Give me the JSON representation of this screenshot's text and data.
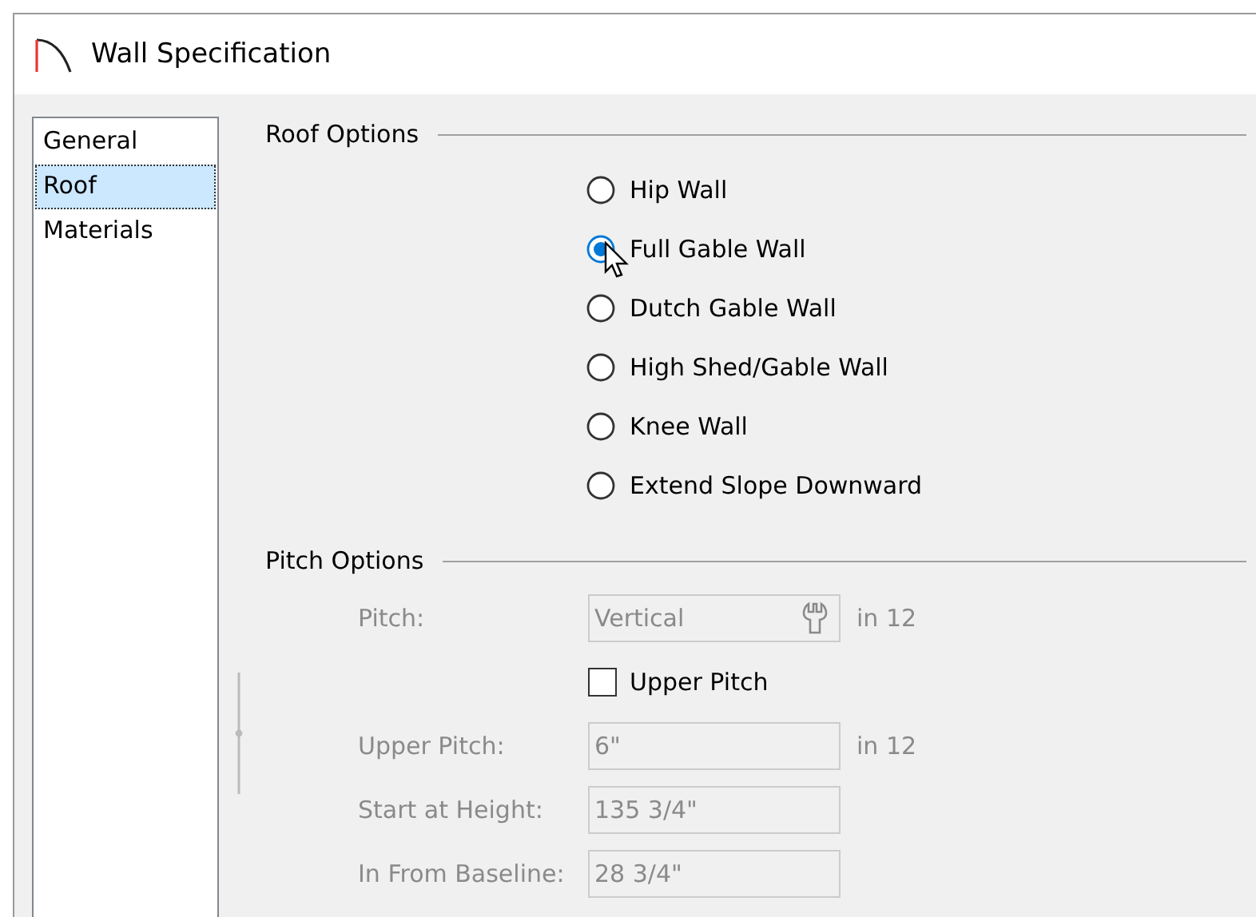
{
  "window": {
    "title": "Wall Specification"
  },
  "sidebar": {
    "items": [
      {
        "label": "General",
        "selected": false
      },
      {
        "label": "Roof",
        "selected": true
      },
      {
        "label": "Materials",
        "selected": false
      }
    ]
  },
  "roof_options": {
    "title": "Roof Options",
    "options": [
      {
        "label": "Hip Wall",
        "selected": false
      },
      {
        "label": "Full Gable Wall",
        "selected": true
      },
      {
        "label": "Dutch Gable Wall",
        "selected": false
      },
      {
        "label": "High Shed/Gable Wall",
        "selected": false
      },
      {
        "label": "Knee Wall",
        "selected": false
      },
      {
        "label": "Extend Slope Downward",
        "selected": false
      }
    ]
  },
  "pitch_options": {
    "title": "Pitch Options",
    "rows": [
      {
        "kind": "field",
        "label": "Pitch:",
        "value": "Vertical",
        "unit": "in 12",
        "disabled": true,
        "tool_button": true
      },
      {
        "kind": "checkbox",
        "label": "Upper Pitch",
        "checked": false
      },
      {
        "kind": "field",
        "label": "Upper Pitch:",
        "value": "6\"",
        "unit": "in 12",
        "disabled": true,
        "tool_button": false
      },
      {
        "kind": "field",
        "label": "Start at Height:",
        "value": "135 3/4\"",
        "disabled": true,
        "tool_button": false
      },
      {
        "kind": "field",
        "label": "In From Baseline:",
        "value": "28 3/4\"",
        "disabled": true,
        "tool_button": false
      }
    ]
  }
}
